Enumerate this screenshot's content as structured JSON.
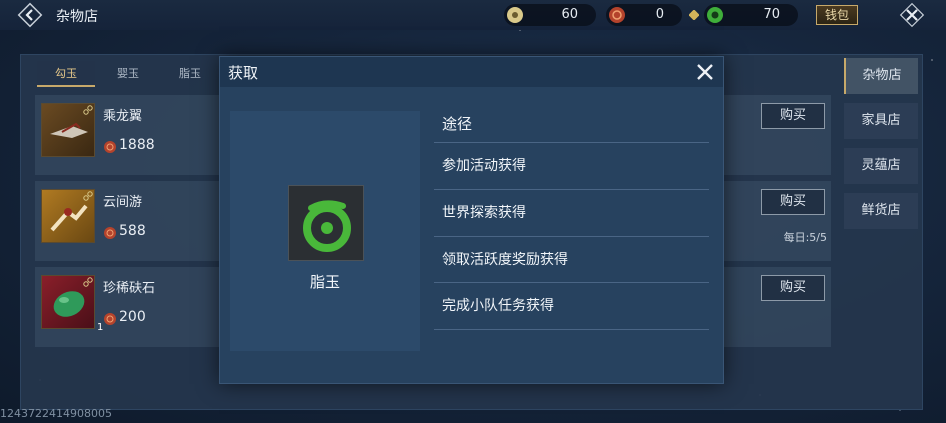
{
  "topbar": {
    "title": "杂物店",
    "currencies": [
      {
        "icon": "jade-coin-icon",
        "value": "60"
      },
      {
        "icon": "red-coin-icon",
        "value": "0"
      },
      {
        "icon": "green-jade-icon",
        "value": "70"
      }
    ],
    "wallet_label": "钱包"
  },
  "tabs": [
    "勾玉",
    "婴玉",
    "脂玉"
  ],
  "items": [
    {
      "name": "乘龙翼",
      "price": "1888",
      "buy_label": "购买"
    },
    {
      "name": "云间游",
      "price": "588",
      "buy_label": "购买",
      "limit": "每日:5/5"
    },
    {
      "name": "珍稀砆石",
      "price": "200",
      "buy_label": "购买",
      "count": "1"
    }
  ],
  "shops": [
    "杂物店",
    "家具店",
    "灵蕴店",
    "鲜货店"
  ],
  "uid": "1243722414908005",
  "modal": {
    "title": "获取",
    "item_name": "脂玉",
    "sources_header": "途径",
    "sources": [
      "参加活动获得",
      "世界探索获得",
      "领取活跃度奖励获得",
      "完成小队任务获得"
    ]
  },
  "colors": {
    "accent_gold": "#c7a96a",
    "panel": "#25364d",
    "modal": "#27425f",
    "jade_green": "#3fae3a"
  }
}
